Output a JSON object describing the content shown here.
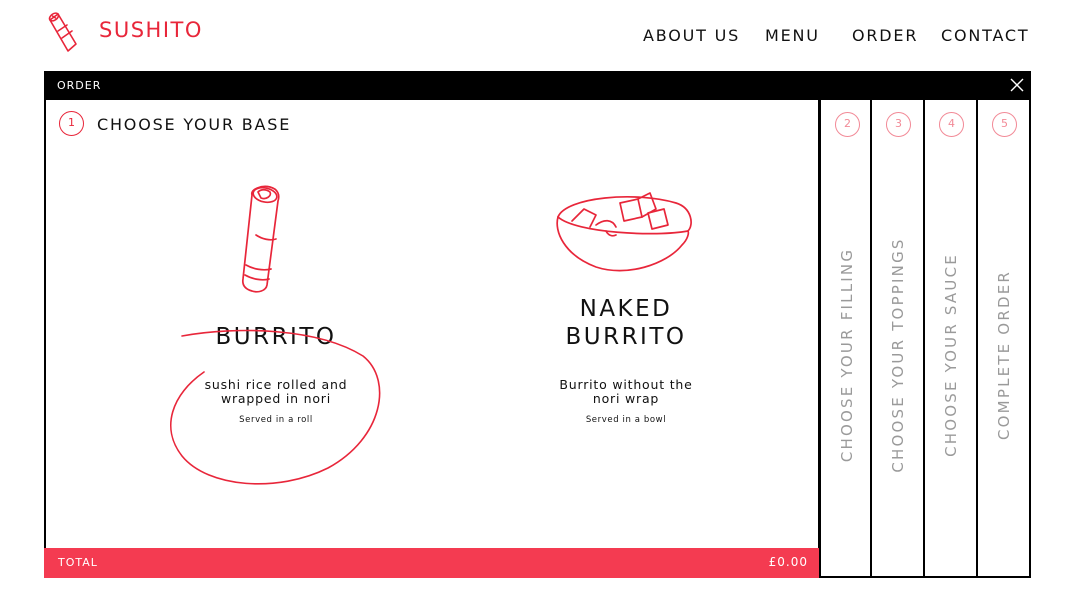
{
  "brand": {
    "name": "SUSHITO",
    "logo_icon": "sushi-roll-icon",
    "accent_color": "#e8263a"
  },
  "nav": {
    "about": "ABOUT US",
    "menu": "MENU",
    "order": "ORDER",
    "contact": "CONTACT"
  },
  "modal": {
    "title": "ORDER",
    "close_icon": "close-icon",
    "current_step": {
      "number": "1",
      "title": "CHOOSE YOUR BASE"
    },
    "options": [
      {
        "icon": "burrito-roll-icon",
        "name_line1": "BURRITO",
        "name_line2": "",
        "desc_line1": "sushi rice rolled and",
        "desc_line2": "wrapped in nori",
        "served": "Served in a roll",
        "selected": true
      },
      {
        "icon": "poke-bowl-icon",
        "name_line1": "NAKED",
        "name_line2": "BURRITO",
        "desc_line1": "Burrito without the",
        "desc_line2": "nori wrap",
        "served": "Served in a bowl",
        "selected": false
      }
    ],
    "steps": [
      {
        "number": "2",
        "label": "CHOOSE YOUR FILLING"
      },
      {
        "number": "3",
        "label": "CHOOSE YOUR TOPPINGS"
      },
      {
        "number": "4",
        "label": "CHOOSE YOUR SAUCE"
      },
      {
        "number": "5",
        "label": "COMPLETE ORDER"
      }
    ],
    "total": {
      "label": "TOTAL",
      "value": "£0.00",
      "bar_color": "#f43b51"
    }
  }
}
